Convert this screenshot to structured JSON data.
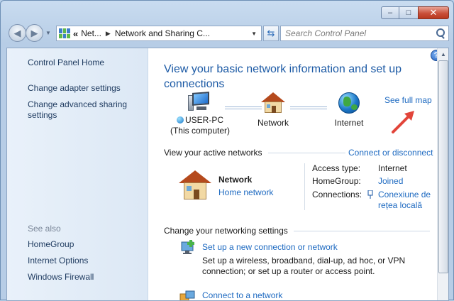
{
  "window": {
    "minimize_label": "–",
    "maximize_label": "□",
    "close_label": "✕"
  },
  "nav": {
    "back_glyph": "◀",
    "forward_glyph": "▶",
    "address_chevron": "«",
    "address_crumbs": [
      "Net...",
      "Network and Sharing C..."
    ],
    "refresh_glyph": "⇆",
    "search_placeholder": "Search Control Panel"
  },
  "sidebar": {
    "home": "Control Panel Home",
    "links": [
      "Change adapter settings",
      "Change advanced sharing settings"
    ],
    "see_also_label": "See also",
    "see_also": [
      "HomeGroup",
      "Internet Options",
      "Windows Firewall"
    ]
  },
  "main": {
    "help_glyph": "?",
    "title": "View your basic network information and set up connections",
    "map": {
      "computer_name": "USER-PC",
      "computer_sub": "(This computer)",
      "network": "Network",
      "internet": "Internet",
      "full_map_link": "See full map"
    },
    "active": {
      "header": "View your active networks",
      "connect_link": "Connect or disconnect",
      "network_name": "Network",
      "network_type": "Home network",
      "access_type_label": "Access type:",
      "access_type_value": "Internet",
      "homegroup_label": "HomeGroup:",
      "homegroup_value": "Joined",
      "connections_label": "Connections:",
      "connections_value": "Conexiune de rețea locală"
    },
    "change": {
      "header": "Change your networking settings",
      "task1_title": "Set up a new connection or network",
      "task1_desc": "Set up a wireless, broadband, dial-up, ad hoc, or VPN connection; or set up a router or access point.",
      "task2_title": "Connect to a network"
    }
  },
  "colors": {
    "link": "#1e6ac1",
    "title": "#1c5aa5",
    "arrow": "#e2453a"
  }
}
